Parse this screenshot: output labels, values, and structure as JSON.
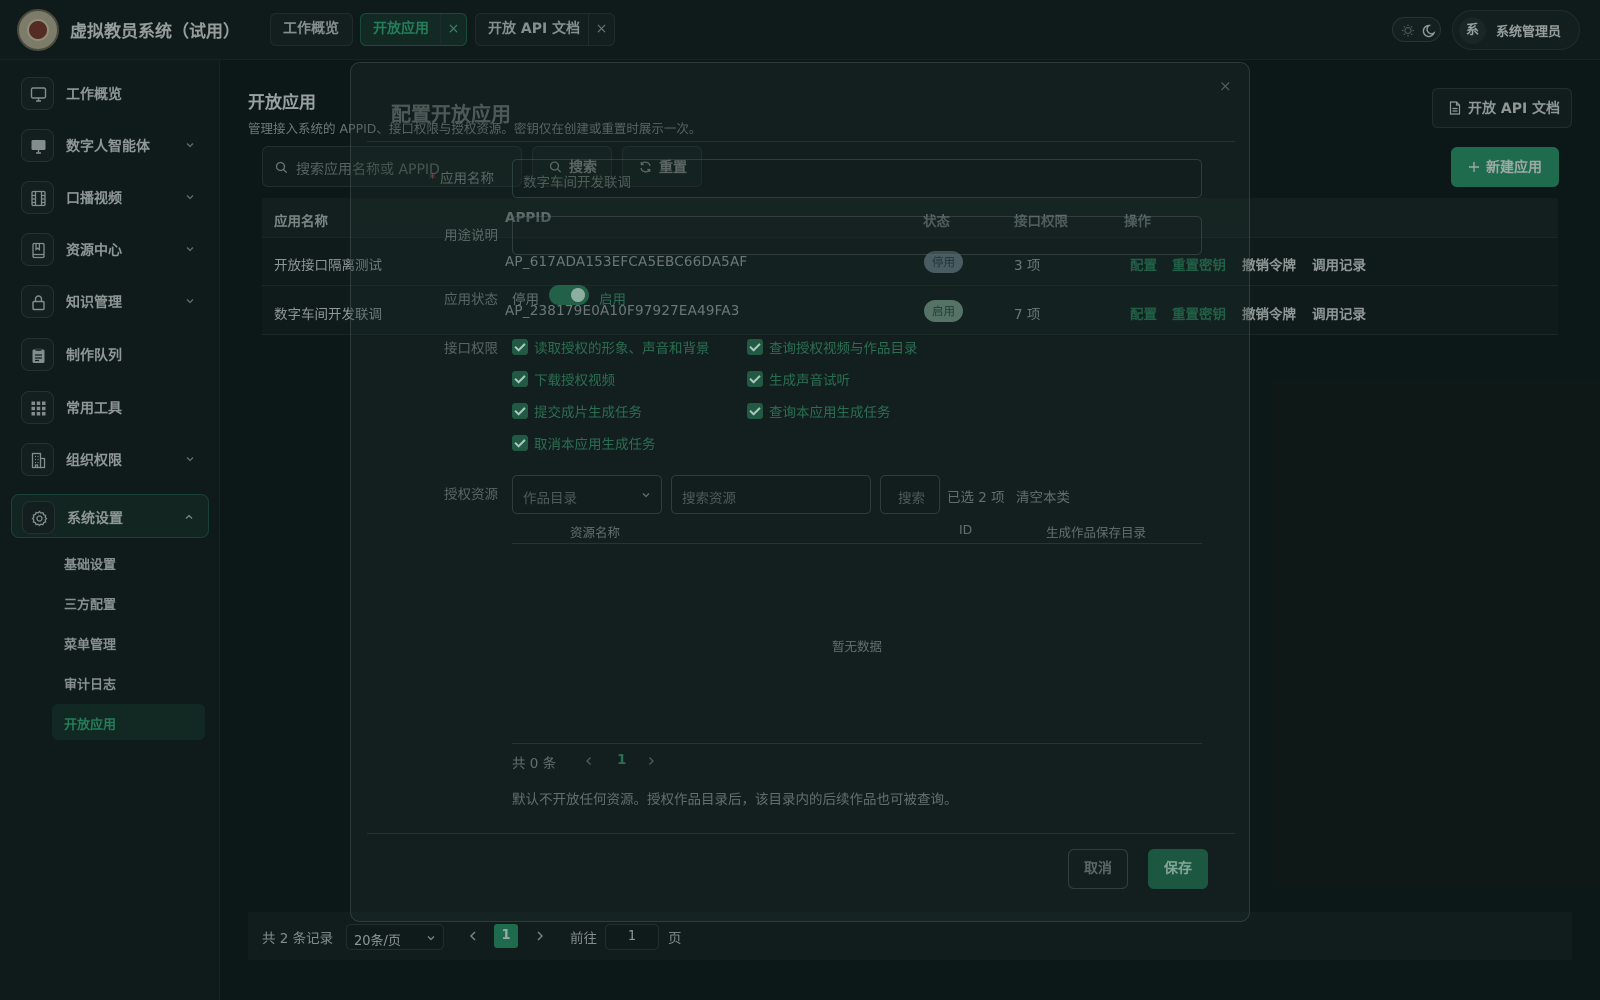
{
  "app": {
    "title": "虚拟教员系统（试用）"
  },
  "header": {
    "tabs": [
      {
        "label": "工作概览"
      },
      {
        "label": "开放应用",
        "active": true
      },
      {
        "label": "开放 API 文档"
      }
    ],
    "close_glyph": "×",
    "user": {
      "avatar_text": "系",
      "name": "系统管理员"
    }
  },
  "sidebar": {
    "items": [
      {
        "label": "工作概览",
        "icon": "monitor-icon"
      },
      {
        "label": "数字人智能体",
        "icon": "display-icon"
      },
      {
        "label": "口播视频",
        "icon": "video-grid-icon"
      },
      {
        "label": "资源中心",
        "icon": "book-icon"
      },
      {
        "label": "知识管理",
        "icon": "lock-icon"
      },
      {
        "label": "制作队列",
        "icon": "clipboard-icon"
      },
      {
        "label": "常用工具",
        "icon": "apps-icon"
      },
      {
        "label": "组织权限",
        "icon": "building-icon"
      },
      {
        "label": "系统设置",
        "icon": "gear-icon"
      }
    ],
    "subitems": [
      {
        "label": "基础设置"
      },
      {
        "label": "三方配置"
      },
      {
        "label": "菜单管理"
      },
      {
        "label": "审计日志"
      },
      {
        "label": "开放应用",
        "active": true
      }
    ]
  },
  "main": {
    "title": "开放应用",
    "subtitle": "管理接入系统的 APPID、接口权限与授权资源。密钥仅在创建或重置时展示一次。",
    "doc_button": "开放 API 文档",
    "new_button": "新建应用",
    "search_placeholder": "搜索应用名称或 APPID",
    "search_button": "搜索",
    "reset_button": "重置"
  },
  "table": {
    "headers": {
      "name": "应用名称",
      "appid": "APPID",
      "status": "状态",
      "perm": "接口权限",
      "ops": "操作"
    },
    "rows": [
      {
        "name": "开放接口隔离测试",
        "appid": "AP_617ADA153EFCA5EBC66DA5AF",
        "status": "停用",
        "perm": "3 项"
      },
      {
        "name": "数字车间开发联调",
        "appid": "AP_238179E0A10F97927EA49FA3",
        "status": "启用",
        "perm": "7 项"
      }
    ],
    "actions": {
      "config": "配置",
      "reset_key": "重置密钥",
      "revoke": "撤销令牌",
      "logs": "调用记录"
    }
  },
  "pager": {
    "total": "共 2 条记录",
    "page_size": "20条/页",
    "current": "1",
    "goto_label": "前往",
    "goto_value": "1",
    "page_unit": "页"
  },
  "modal": {
    "title": "配置开放应用",
    "close_glyph": "×",
    "name_label": "应用名称",
    "name_value": "数字车间开发联调",
    "desc_label": "用途说明",
    "status_label": "应用状态",
    "status_off": "停用",
    "status_on": "启用",
    "perm_label": "接口权限",
    "permissions": [
      "读取授权的形象、声音和背景",
      "查询授权视频与作品目录",
      "下载授权视频",
      "生成声音试听",
      "提交成片生成任务",
      "查询本应用生成任务",
      "取消本应用生成任务"
    ],
    "res_label": "授权资源",
    "res_category": "作品目录",
    "res_search_placeholder": "搜索资源",
    "res_search_button": "搜索",
    "res_selected": "已选 2 项",
    "res_clear": "清空本类",
    "res_headers": {
      "name": "资源名称",
      "id": "ID",
      "dir": "生成作品保存目录"
    },
    "res_empty": "暂无数据",
    "res_total": "共 0 条",
    "res_page": "1",
    "note": "默认不开放任何资源。授权作品目录后，该目录内的后续作品也可被查询。",
    "cancel": "取消",
    "save": "保存"
  },
  "colors": {
    "accent": "#2a9b6c",
    "background": "#0f1b1a"
  }
}
